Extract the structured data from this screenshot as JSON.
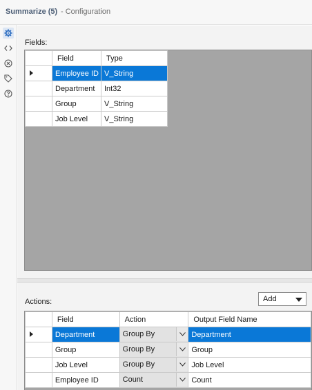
{
  "window": {
    "title": "Summarize (5)",
    "subtitle": "- Configuration"
  },
  "sidebar": {
    "items": [
      {
        "name": "configuration",
        "icon": "gear-icon",
        "active": true
      },
      {
        "name": "xml",
        "icon": "code-brackets-icon"
      },
      {
        "name": "close",
        "icon": "circle-x-icon"
      },
      {
        "name": "annotation",
        "icon": "tag-icon"
      },
      {
        "name": "help",
        "icon": "question-circle-icon"
      }
    ]
  },
  "fields": {
    "label": "Fields:",
    "columns": [
      "Field",
      "Type"
    ],
    "rows": [
      {
        "field": "Employee ID",
        "type": "V_String",
        "selected": true
      },
      {
        "field": "Department",
        "type": "Int32"
      },
      {
        "field": "Group",
        "type": "V_String"
      },
      {
        "field": "Job Level",
        "type": "V_String"
      }
    ]
  },
  "actions": {
    "label": "Actions:",
    "add_label": "Add",
    "columns": [
      "Field",
      "Action",
      "Output Field Name"
    ],
    "rows": [
      {
        "field": "Department",
        "action": "Group By",
        "output": "Department",
        "selected": true
      },
      {
        "field": "Group",
        "action": "Group By",
        "output": "Group"
      },
      {
        "field": "Job Level",
        "action": "Group By",
        "output": "Job Level"
      },
      {
        "field": "Employee ID",
        "action": "Count",
        "output": "Count"
      }
    ]
  },
  "colors": {
    "selection": "#0a78d7",
    "grid_background": "#a5a5a5",
    "title_text": "#4a5c74"
  }
}
